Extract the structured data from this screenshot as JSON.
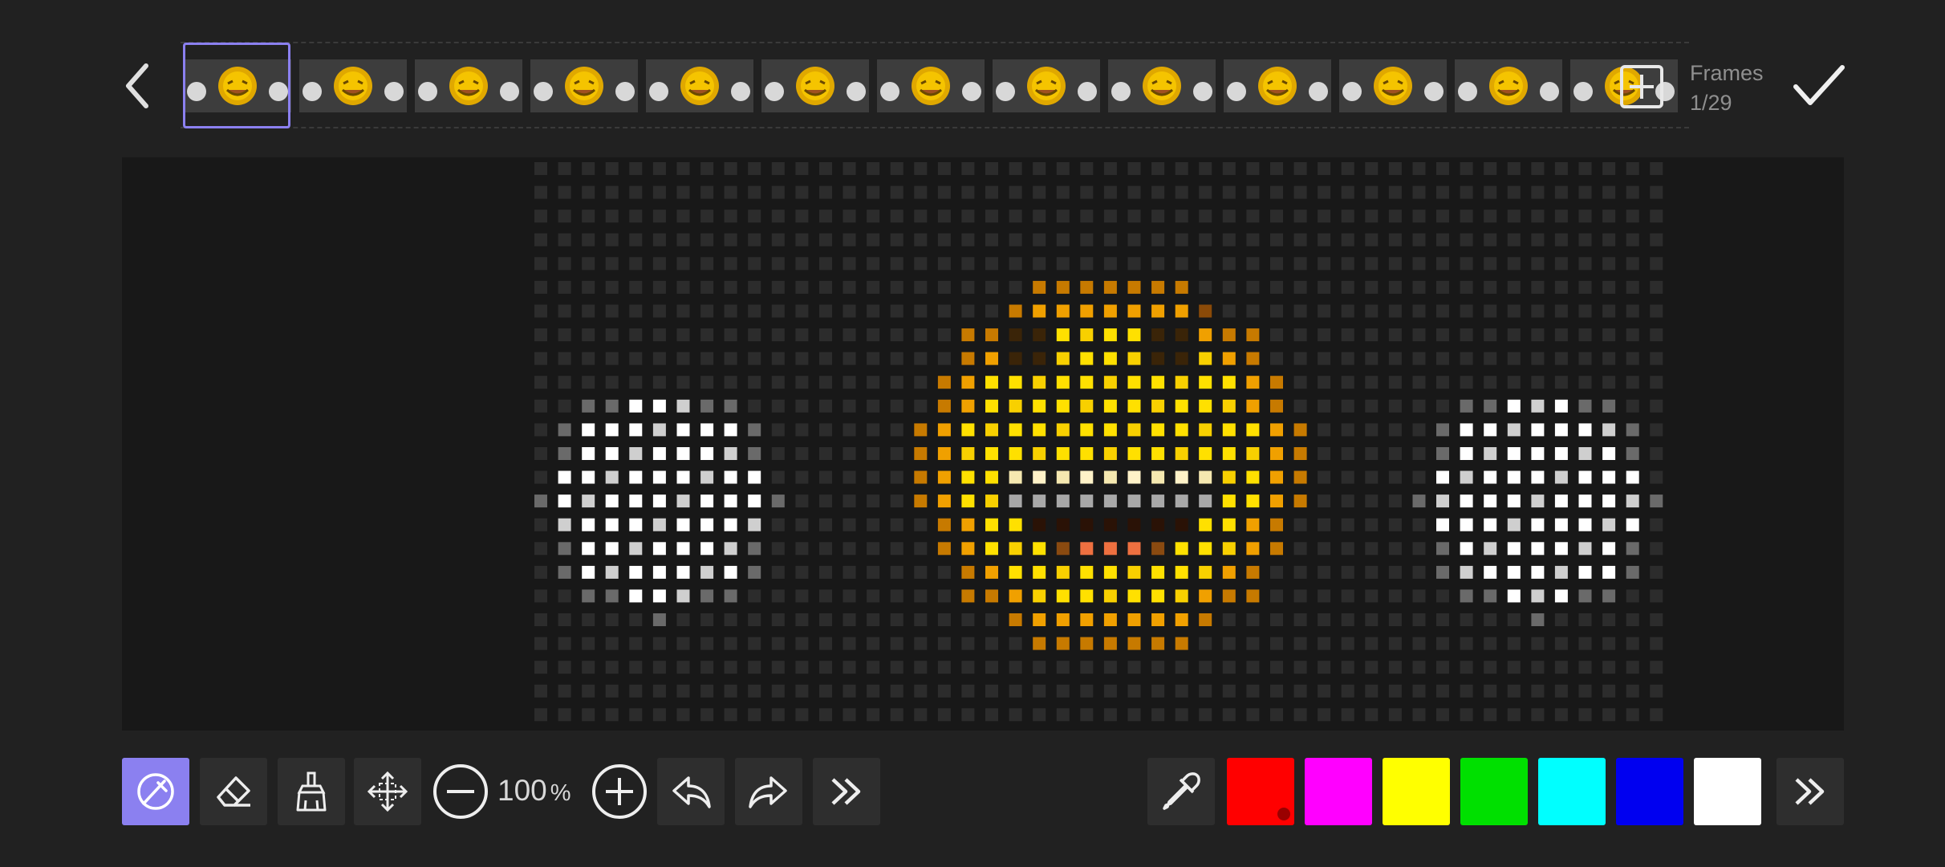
{
  "header": {
    "frames_label": "Frames",
    "frames_count": "1/29",
    "thumbnail_count": 13
  },
  "toolbar": {
    "zoom_value": "100",
    "zoom_unit": "%"
  },
  "palette": {
    "colors": [
      "#ff0000",
      "#ff00ff",
      "#ffff00",
      "#00e000",
      "#00ffff",
      "#0000f0",
      "#ffffff"
    ],
    "selected": "#ff0000"
  },
  "icons": {
    "back": "chevron-left-icon",
    "add_frame": "plus-square-icon",
    "confirm": "check-icon",
    "draw": "pen-circle-icon",
    "eraser": "eraser-icon",
    "clear": "broom-icon",
    "move": "move-arrows-icon",
    "zoom_out": "minus-circle-icon",
    "zoom_in": "plus-circle-icon",
    "undo": "undo-icon",
    "redo": "redo-icon",
    "more": "double-chevron-right-icon",
    "eyedropper": "eyedropper-icon"
  }
}
